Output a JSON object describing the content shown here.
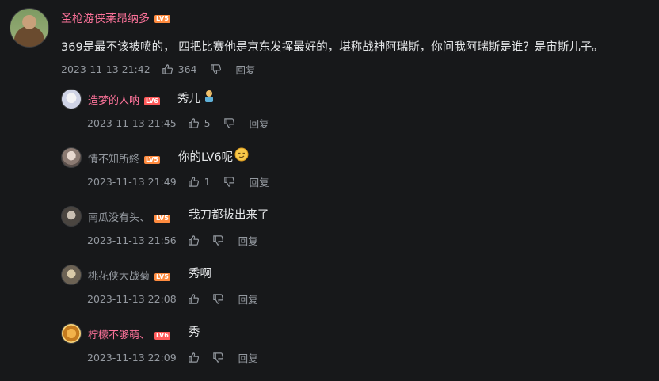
{
  "main": {
    "username": "圣枪游侠莱昂纳多",
    "level": "LV5",
    "content": "369是最不该被喷的， 四把比赛他是京东发挥最好的，堪称战神阿瑞斯，你问我阿瑞斯是谁？是宙斯儿子。",
    "time": "2023-11-13 21:42",
    "likes": "364",
    "reply_label": "回复"
  },
  "replies": [
    {
      "username": "造梦的人呐",
      "level": "LV6",
      "text": "秀儿",
      "emoji": "person-emoji",
      "time": "2023-11-13 21:45",
      "likes": "5",
      "reply_label": "回复"
    },
    {
      "username": "情不知所終",
      "level": "LV5",
      "text": "你的LV6呢",
      "emoji": "smirk-emoji",
      "time": "2023-11-13 21:49",
      "likes": "1",
      "reply_label": "回复"
    },
    {
      "username": "南瓜没有头、",
      "level": "LV5",
      "text": "我刀都拔出来了",
      "time": "2023-11-13 21:56",
      "likes": "",
      "reply_label": "回复"
    },
    {
      "username": "桃花侠大战菊",
      "level": "LV5",
      "text": "秀啊",
      "time": "2023-11-13 22:08",
      "likes": "",
      "reply_label": "回复"
    },
    {
      "username": "柠檬不够萌、",
      "level": "LV6",
      "text": "秀",
      "time": "2023-11-13 22:09",
      "likes": "",
      "reply_label": "回复"
    }
  ],
  "colors": {
    "background": "#17181a",
    "vip_name": "#fb7299",
    "normal_name": "#9499a0",
    "text": "#e3e5e7",
    "meta": "#9499a0"
  }
}
